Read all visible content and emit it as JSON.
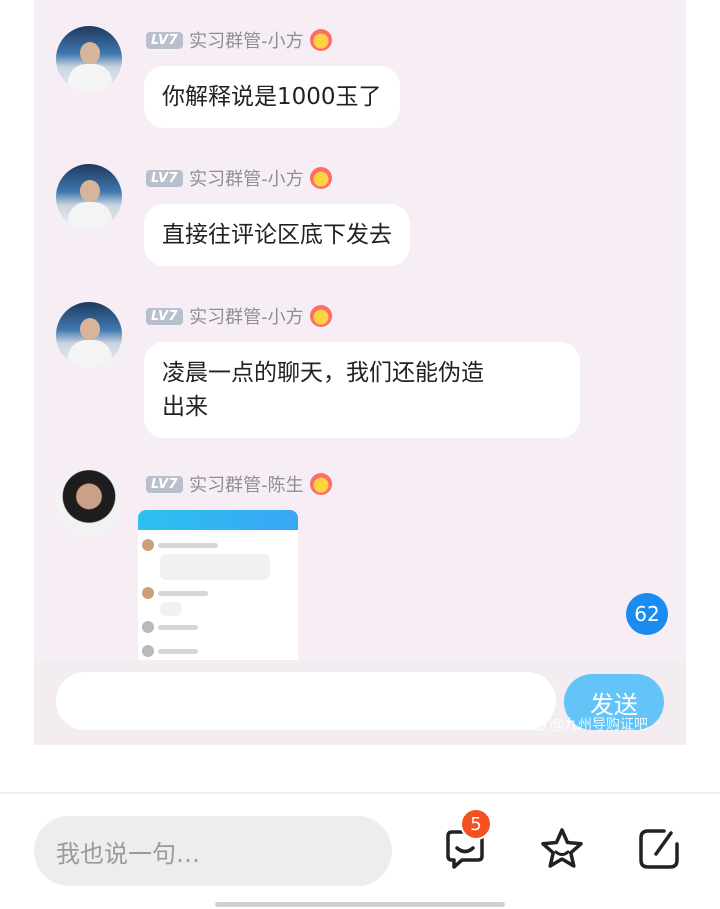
{
  "messages": [
    {
      "level": "LV7",
      "sender": "实习群管-小方",
      "text": "你解释说是1000玉了"
    },
    {
      "level": "LV7",
      "sender": "实习群管-小方",
      "text": "直接往评论区底下发去"
    },
    {
      "level": "LV7",
      "sender": "实习群管-小方",
      "text_line1": "凌晨一点的聊天，我们还能伪造",
      "text_line2": "出来"
    },
    {
      "level": "LV7",
      "sender": "实习群管-陈生"
    }
  ],
  "unread_count": "62",
  "chat_input": {
    "send_label": "发送"
  },
  "watermark": "@九州导购证吧",
  "bottom_bar": {
    "placeholder": "我也说一句…",
    "comment_count": "5"
  },
  "colors": {
    "accent": "#1a8cf0",
    "send_button": "#64c4f8",
    "badge": "#f4511e",
    "chat_bg": "#f6eef4"
  },
  "icons": [
    "comment-icon",
    "star-icon",
    "share-icon",
    "smiley-badge-icon"
  ]
}
